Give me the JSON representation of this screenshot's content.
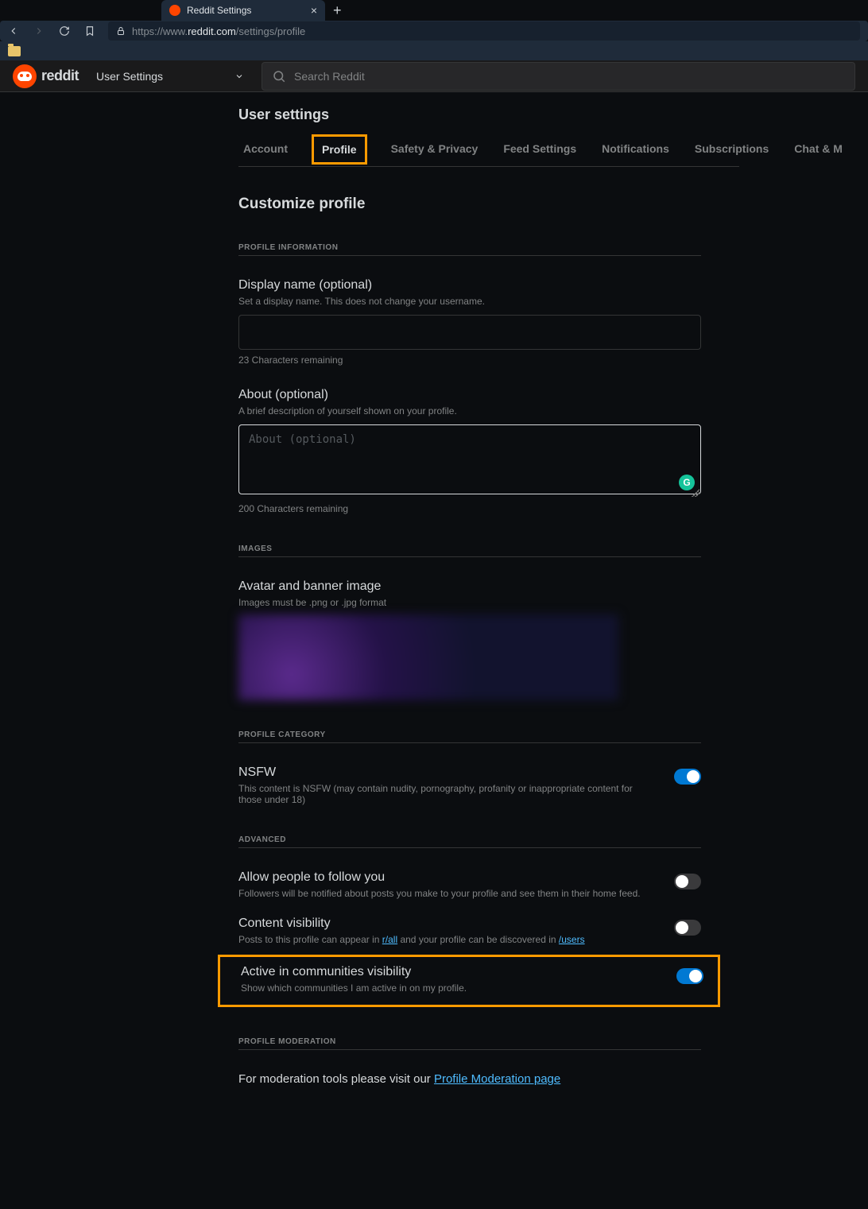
{
  "browser": {
    "tab_title": "Reddit Settings",
    "url_prefix": "https://",
    "url_host": "www.",
    "url_domain": "reddit.com",
    "url_path": "/settings/profile"
  },
  "header": {
    "brand": "reddit",
    "dropdown_label": "User Settings",
    "search_placeholder": "Search Reddit"
  },
  "page": {
    "title": "User settings",
    "section_title": "Customize profile"
  },
  "tabs": [
    "Account",
    "Profile",
    "Safety & Privacy",
    "Feed Settings",
    "Notifications",
    "Subscriptions",
    "Chat & M"
  ],
  "profile_info": {
    "category": "PROFILE INFORMATION",
    "display_name_label": "Display name (optional)",
    "display_name_desc": "Set a display name. This does not change your username.",
    "display_name_counter": "23 Characters remaining",
    "about_label": "About (optional)",
    "about_desc": "A brief description of yourself shown on your profile.",
    "about_placeholder": "About (optional)",
    "about_counter": "200 Characters remaining"
  },
  "images": {
    "category": "IMAGES",
    "avatar_label": "Avatar and banner image",
    "avatar_desc": "Images must be .png or .jpg format"
  },
  "profile_category": {
    "category": "PROFILE CATEGORY",
    "nsfw_label": "NSFW",
    "nsfw_desc": "This content is NSFW (may contain nudity, pornography, profanity or inappropriate content for those under 18)"
  },
  "advanced": {
    "category": "ADVANCED",
    "follow_label": "Allow people to follow you",
    "follow_desc": "Followers will be notified about posts you make to your profile and see them in their home feed.",
    "content_vis_label": "Content visibility",
    "content_vis_desc_pre": "Posts to this profile can appear in ",
    "content_vis_link1": "r/all",
    "content_vis_desc_mid": " and your profile can be discovered in ",
    "content_vis_link2": "/users",
    "active_label": "Active in communities visibility",
    "active_desc": "Show which communities I am active in on my profile."
  },
  "moderation": {
    "category": "PROFILE MODERATION",
    "text_pre": "For moderation tools please visit our ",
    "link_text": "Profile Moderation page"
  },
  "toggles": {
    "nsfw": true,
    "follow": false,
    "content_visibility": false,
    "active_communities": true
  }
}
